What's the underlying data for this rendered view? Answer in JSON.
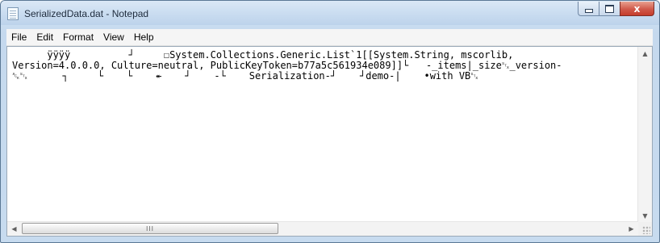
{
  "window": {
    "title": "SerializedData.dat - Notepad",
    "controls": {
      "minimize": "",
      "maximize": "",
      "close": "x"
    }
  },
  "menu": [
    "File",
    "Edit",
    "Format",
    "View",
    "Help"
  ],
  "editor": {
    "lines": [
      "      ÿÿÿÿ          ┘     ☐System.Collections.Generic.List`1[[System.String, mscorlib,",
      "Version=4.0.0.0, Culture=neutral, PublicKeyToken=b77a5c561934e089]]└   -_items|_size␂_version-",
      "␆␂      ┐     └    └    ↞    ┘    -└    Serialization-┘    ┘demo-|    •with VB␂"
    ]
  },
  "scrollbars": {
    "horizontal_thumb_grip": "III"
  }
}
